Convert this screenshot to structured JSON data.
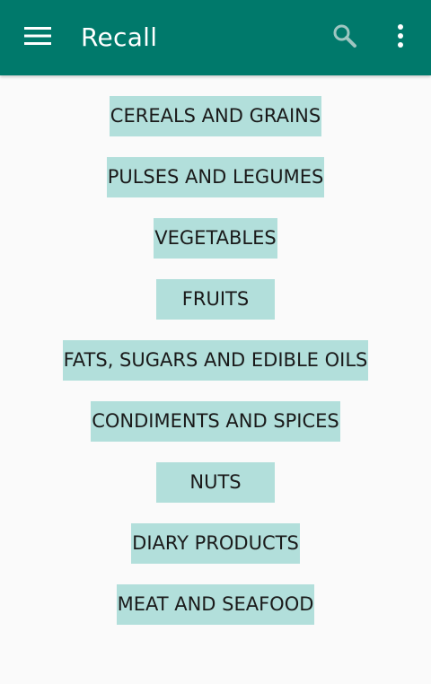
{
  "app_bar": {
    "title": "Recall",
    "menu_icon": "hamburger-menu-icon",
    "search_icon": "search-icon",
    "more_icon": "more-vert-icon",
    "color": "#00796b"
  },
  "categories": [
    {
      "label": "CEREALS AND GRAINS"
    },
    {
      "label": "PULSES AND LEGUMES"
    },
    {
      "label": "VEGETABLES"
    },
    {
      "label": "FRUITS"
    },
    {
      "label": "FATS, SUGARS AND EDIBLE OILS"
    },
    {
      "label": "CONDIMENTS AND SPICES"
    },
    {
      "label": "NUTS"
    },
    {
      "label": "DIARY PRODUCTS"
    },
    {
      "label": "MEAT AND SEAFOOD"
    }
  ],
  "colors": {
    "button_background": "#b2dfdb",
    "page_background": "#fafafa"
  }
}
